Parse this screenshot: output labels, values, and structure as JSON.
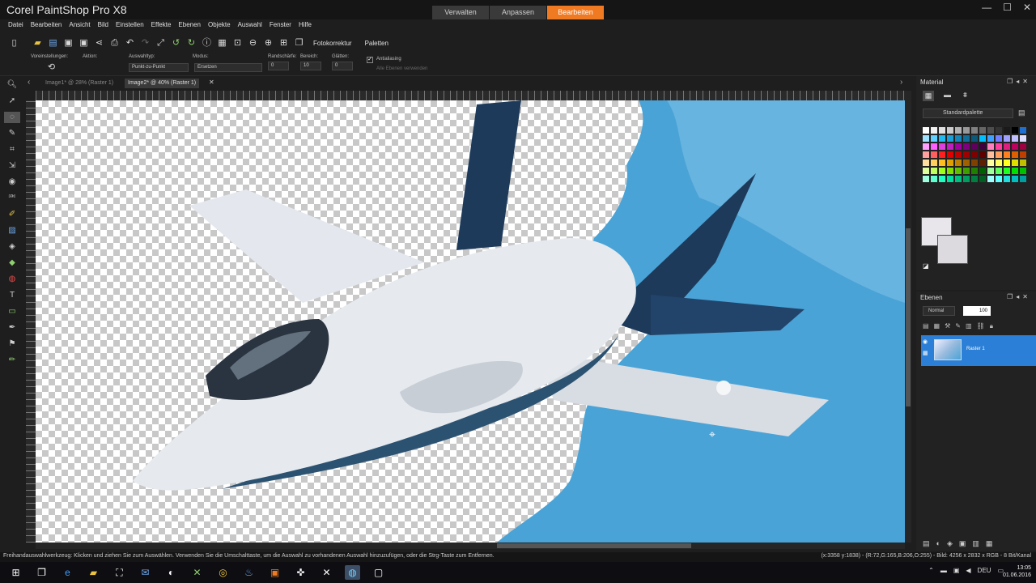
{
  "app": {
    "title": "Corel PaintShop Pro X8"
  },
  "workspace_tabs": [
    {
      "label": "Verwalten",
      "active": false
    },
    {
      "label": "Anpassen",
      "active": false
    },
    {
      "label": "Bearbeiten",
      "active": true
    }
  ],
  "window_controls": {
    "minimize": "—",
    "maximize": "☐",
    "close": "✕"
  },
  "menu": [
    "Datei",
    "Bearbeiten",
    "Ansicht",
    "Bild",
    "Einstellen",
    "Effekte",
    "Ebenen",
    "Objekte",
    "Auswahl",
    "Fenster",
    "Hilfe"
  ],
  "toolbar": {
    "foto_label": "Fotokorrektur",
    "paletten_label": "Paletten"
  },
  "options": {
    "voreinstellungen": "Voreinstellungen:",
    "aktion": "Aktion:",
    "auswahltyp_label": "Auswahltyp:",
    "auswahltyp_value": "Punkt-zu-Punkt",
    "modus_label": "Modus:",
    "modus_value": "Ersetzen",
    "randschaerfe_label": "Randschärfe:",
    "randschaerfe_value": "0",
    "bereich_label": "Bereich:",
    "bereich_value": "10",
    "glaetten_label": "Glätten:",
    "glaetten_value": "0",
    "antialiasing_label": "Antialiasing",
    "alle_ebenen_label": "Alle Ebenen verwenden"
  },
  "documents": [
    {
      "label": "Image1* @ 28% (Raster 1)",
      "active": false
    },
    {
      "label": "Image2* @ 40% (Raster 1)",
      "active": true
    }
  ],
  "material": {
    "title": "Material",
    "palette": "Standardpalette",
    "swatches": [
      "#ffffff",
      "#f2f2f2",
      "#e0e0e0",
      "#cccccc",
      "#b3b3b3",
      "#999999",
      "#808080",
      "#666666",
      "#4d4d4d",
      "#333333",
      "#1a1a1a",
      "#000000",
      "#1f6fd0",
      "#9fe2ff",
      "#5fd0ff",
      "#22b8f0",
      "#1a9fd8",
      "#1686b8",
      "#106e98",
      "#0b5878",
      "#00bfff",
      "#3f9fff",
      "#6f7fff",
      "#9f9fff",
      "#bfbfff",
      "#dfdfff",
      "#ff9fff",
      "#ff5fff",
      "#e03fe0",
      "#bf1fbf",
      "#9f009f",
      "#7f007f",
      "#5f005f",
      "#3f003f",
      "#ff7fbf",
      "#ff3f9f",
      "#df1f7f",
      "#bf005f",
      "#9f003f",
      "#ff9f9f",
      "#ff5f5f",
      "#ff1f1f",
      "#df0000",
      "#bf0000",
      "#9f0000",
      "#7f0000",
      "#5f0000",
      "#ffbf9f",
      "#ff9f5f",
      "#ff7f1f",
      "#df5f00",
      "#bf3f00",
      "#ffdf9f",
      "#ffcf5f",
      "#ffbf1f",
      "#dfa000",
      "#bf8000",
      "#9f6000",
      "#7f4000",
      "#5f2000",
      "#ffff9f",
      "#ffff5f",
      "#ffff1f",
      "#dfdf00",
      "#bfbf00",
      "#dfff9f",
      "#bfff5f",
      "#9fff1f",
      "#7fdf00",
      "#5fbf00",
      "#3f9f00",
      "#1f7f00",
      "#005f00",
      "#9fff9f",
      "#5fff5f",
      "#1fff1f",
      "#00df00",
      "#00bf00",
      "#9fffdf",
      "#5fffcf",
      "#1fffbf",
      "#00dfa0",
      "#00bf80",
      "#009f60",
      "#007f40",
      "#005f20",
      "#9fffff",
      "#5fffff",
      "#1fdfdf",
      "#00bfbf",
      "#009f9f"
    ]
  },
  "layers": {
    "title": "Ebenen",
    "blend_mode": "Normal",
    "opacity": "100",
    "items": [
      {
        "name": "Raster 1",
        "selected": true
      }
    ]
  },
  "status": {
    "hint": "Freihandauswahlwerkzeug: Klicken und ziehen Sie zum Auswählen. Verwenden Sie die Umschalttaste, um die Auswahl zu vorhandenen Auswahl hinzuzufügen, oder die Strg-Taste zum Entfernen.",
    "info": "(x:3358 y:1838) - (R:72,G:165,B:206,O:255) - Bild: 4256 x 2832 x RGB - 8 Bit/Kanal"
  },
  "taskbar": {
    "tray_lang": "DEU",
    "time": "13:05",
    "date": "01.06.2016"
  },
  "colors": {
    "accent": "#f07a22",
    "layer_selected": "#2b7fd6",
    "sky": "#4aa3d6"
  }
}
